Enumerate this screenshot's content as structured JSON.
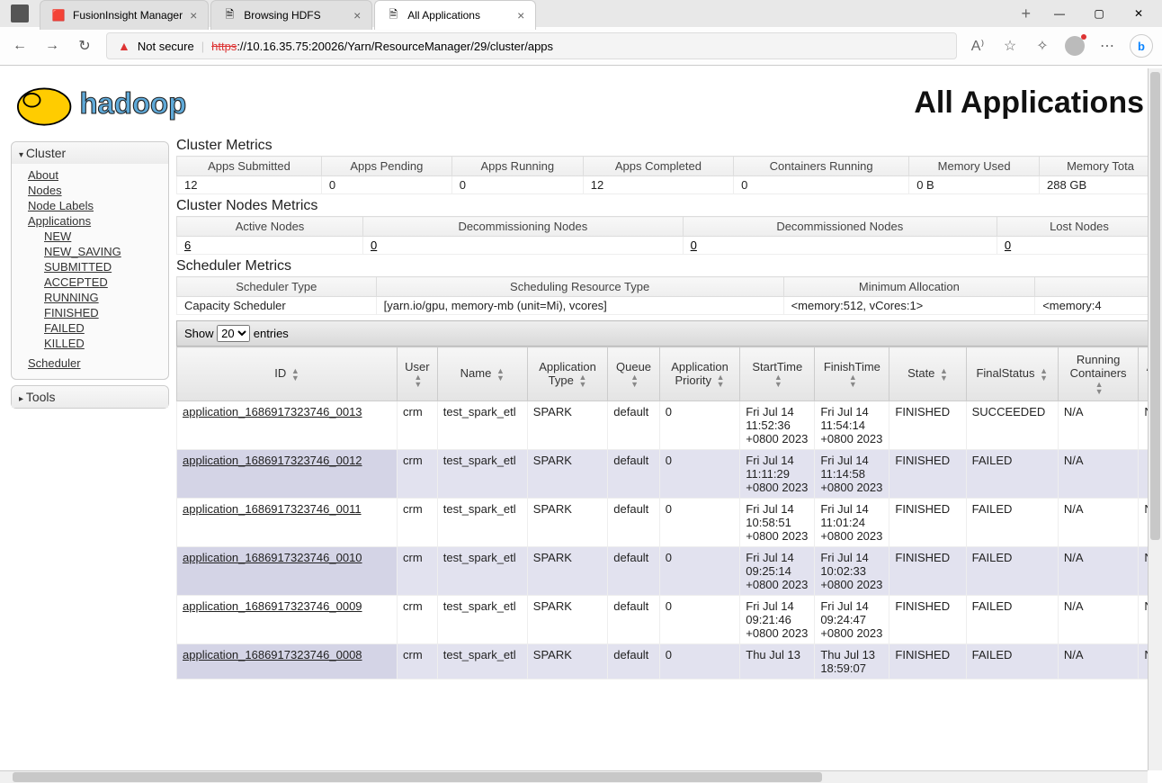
{
  "browser": {
    "tabs": [
      {
        "title": "FusionInsight Manager",
        "icon": "🟥",
        "active": false
      },
      {
        "title": "Browsing HDFS",
        "icon": "🗎",
        "active": false
      },
      {
        "title": "All Applications",
        "icon": "🗎",
        "active": true
      }
    ],
    "not_secure": "Not secure",
    "url_scheme": "https",
    "url_rest": "://10.16.35.75:20026/Yarn/ResourceManager/29/cluster/apps"
  },
  "page_title": "All Applications",
  "sidebar": {
    "title1": "Cluster",
    "title2": "Tools",
    "items": [
      "About",
      "Nodes",
      "Node Labels",
      "Applications"
    ],
    "subitems": [
      "NEW",
      "NEW_SAVING",
      "SUBMITTED",
      "ACCEPTED",
      "RUNNING",
      "FINISHED",
      "FAILED",
      "KILLED"
    ],
    "scheduler": "Scheduler"
  },
  "sections": {
    "cluster_metrics": "Cluster Metrics",
    "nodes_metrics": "Cluster Nodes Metrics",
    "scheduler_metrics": "Scheduler Metrics"
  },
  "cluster_metrics": {
    "headers": [
      "Apps Submitted",
      "Apps Pending",
      "Apps Running",
      "Apps Completed",
      "Containers Running",
      "Memory Used",
      "Memory Tota"
    ],
    "values": [
      "12",
      "0",
      "0",
      "12",
      "0",
      "0 B",
      "288 GB"
    ]
  },
  "nodes_metrics": {
    "headers": [
      "Active Nodes",
      "Decommissioning Nodes",
      "Decommissioned Nodes",
      "Lost Nodes"
    ],
    "values": [
      "6",
      "0",
      "0",
      "0"
    ]
  },
  "scheduler": {
    "headers": [
      "Scheduler Type",
      "Scheduling Resource Type",
      "Minimum Allocation",
      ""
    ],
    "values": [
      "Capacity Scheduler",
      "[yarn.io/gpu, memory-mb (unit=Mi), vcores]",
      "<memory:512, vCores:1>",
      "<memory:4"
    ]
  },
  "entries": {
    "show": "Show",
    "count": "20",
    "suffix": "entries"
  },
  "table": {
    "headers": [
      "ID",
      "User",
      "Name",
      "Application Type",
      "Queue",
      "Application Priority",
      "StartTime",
      "FinishTime",
      "State",
      "FinalStatus",
      "Running Containers",
      "A"
    ],
    "rows": [
      {
        "id": "application_1686917323746_0013",
        "user": "crm",
        "name": "test_spark_etl",
        "type": "SPARK",
        "queue": "default",
        "prio": "0",
        "start": "Fri Jul 14 11:52:36 +0800 2023",
        "finish": "Fri Jul 14 11:54:14 +0800 2023",
        "state": "FINISHED",
        "final": "SUCCEEDED",
        "rc": "N/A",
        "a": "N"
      },
      {
        "id": "application_1686917323746_0012",
        "user": "crm",
        "name": "test_spark_etl",
        "type": "SPARK",
        "queue": "default",
        "prio": "0",
        "start": "Fri Jul 14 11:11:29 +0800 2023",
        "finish": "Fri Jul 14 11:14:58 +0800 2023",
        "state": "FINISHED",
        "final": "FAILED",
        "rc": "N/A",
        "a": ""
      },
      {
        "id": "application_1686917323746_0011",
        "user": "crm",
        "name": "test_spark_etl",
        "type": "SPARK",
        "queue": "default",
        "prio": "0",
        "start": "Fri Jul 14 10:58:51 +0800 2023",
        "finish": "Fri Jul 14 11:01:24 +0800 2023",
        "state": "FINISHED",
        "final": "FAILED",
        "rc": "N/A",
        "a": "N"
      },
      {
        "id": "application_1686917323746_0010",
        "user": "crm",
        "name": "test_spark_etl",
        "type": "SPARK",
        "queue": "default",
        "prio": "0",
        "start": "Fri Jul 14 09:25:14 +0800 2023",
        "finish": "Fri Jul 14 10:02:33 +0800 2023",
        "state": "FINISHED",
        "final": "FAILED",
        "rc": "N/A",
        "a": "N"
      },
      {
        "id": "application_1686917323746_0009",
        "user": "crm",
        "name": "test_spark_etl",
        "type": "SPARK",
        "queue": "default",
        "prio": "0",
        "start": "Fri Jul 14 09:21:46 +0800 2023",
        "finish": "Fri Jul 14 09:24:47 +0800 2023",
        "state": "FINISHED",
        "final": "FAILED",
        "rc": "N/A",
        "a": "N"
      },
      {
        "id": "application_1686917323746_0008",
        "user": "crm",
        "name": "test_spark_etl",
        "type": "SPARK",
        "queue": "default",
        "prio": "0",
        "start": "Thu Jul 13",
        "finish": "Thu Jul 13 18:59:07",
        "state": "FINISHED",
        "final": "FAILED",
        "rc": "N/A",
        "a": "N"
      }
    ]
  }
}
